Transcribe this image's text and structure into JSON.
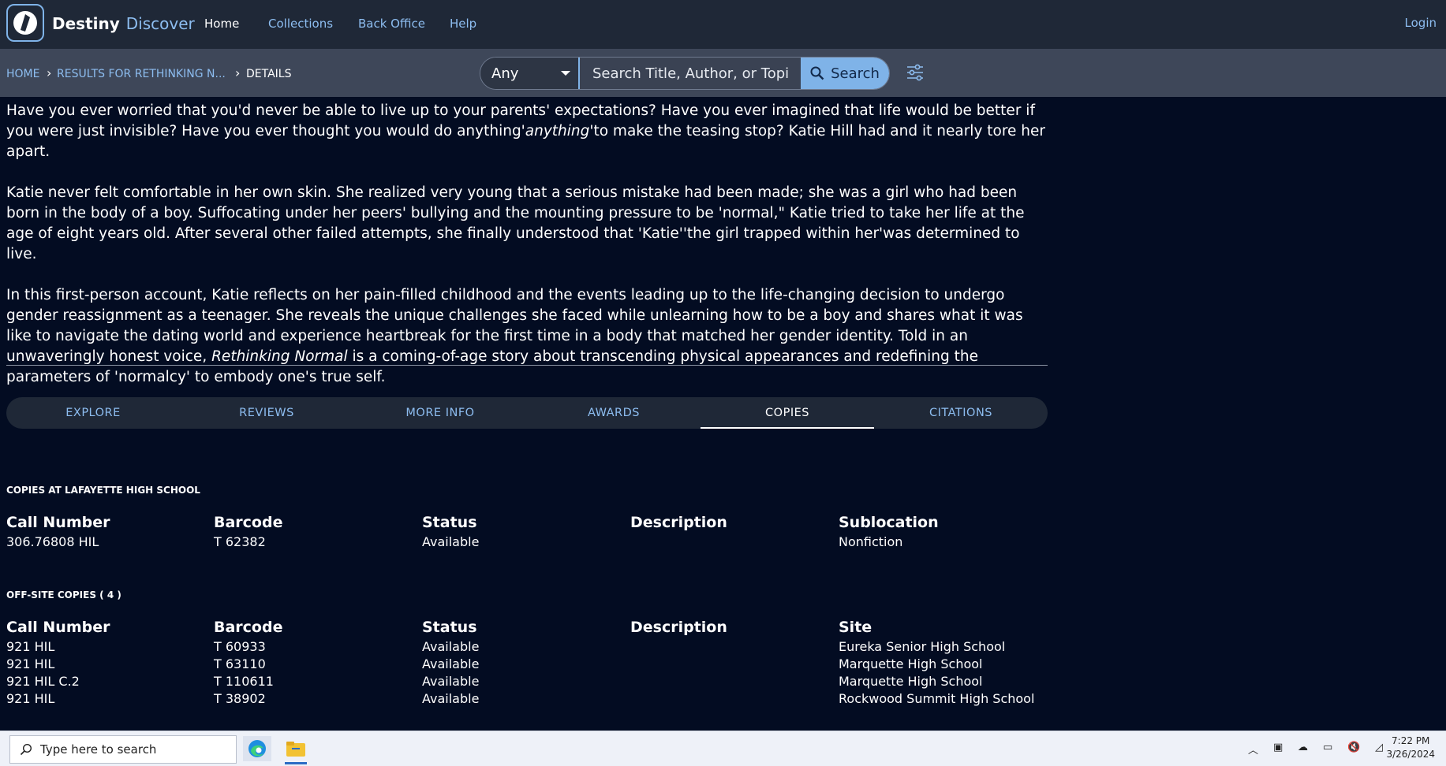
{
  "header": {
    "brand_primary": "Destiny",
    "brand_secondary": "Discover",
    "nav": [
      "Home",
      "Collections",
      "Back Office",
      "Help"
    ],
    "active_nav": "Home",
    "login": "Login"
  },
  "breadcrumb": [
    "HOME",
    "RESULTS FOR RETHINKING N...",
    "DETAILS"
  ],
  "search": {
    "scope": "Any",
    "placeholder": "Search Title, Author, or Topic",
    "button": "Search"
  },
  "description": {
    "p1a": "Have you ever worried that you'd never be able to live up to your parents' expectations? Have you ever imagined that life would be better if you were just invisible? Have you ever thought you would do anything'",
    "p1_em": "anything",
    "p1b": "'to make the teasing stop? Katie Hill had and it nearly tore her apart.",
    "p2": "Katie never felt comfortable in her own skin. She realized very young that a serious mistake had been made; she was a girl who had been born in the body of a boy. Suffocating under her peers' bullying and the mounting pressure to be 'normal,\" Katie tried to take her life at the age of eight years old. After several other failed attempts, she finally understood that 'Katie''the girl trapped within her'was determined to live.",
    "p3a": "In this first-person account, Katie reflects on her pain-filled childhood and the events leading up to the life-changing decision to undergo gender reassignment as a teenager. She reveals the unique challenges she faced while unlearning how to be a boy and shares what it was like to navigate the dating world and experience heartbreak for the first time in a body that matched her gender identity. Told in an unwaveringly honest voice, ",
    "p3_em": "Rethinking Normal",
    "p3b": " is a coming-of-age story about transcending physical appearances and redefining the parameters of 'normalcy' to embody one's true self."
  },
  "tabs": [
    "EXPLORE",
    "REVIEWS",
    "MORE INFO",
    "AWARDS",
    "COPIES",
    "CITATIONS"
  ],
  "active_tab": "COPIES",
  "local_copies": {
    "heading": "COPIES AT LAFAYETTE HIGH SCHOOL",
    "columns": [
      "Call Number",
      "Barcode",
      "Status",
      "Description",
      "Sublocation"
    ],
    "rows": [
      [
        "306.76808 HIL",
        "T 62382",
        "Available",
        "",
        "Nonfiction"
      ]
    ]
  },
  "offsite_copies": {
    "heading": "OFF-SITE COPIES ( 4 )",
    "columns": [
      "Call Number",
      "Barcode",
      "Status",
      "Description",
      "Site"
    ],
    "rows": [
      [
        "921 HIL",
        "T 60933",
        "Available",
        "",
        "Eureka Senior High School"
      ],
      [
        "921 HIL",
        "T 63110",
        "Available",
        "",
        "Marquette High School"
      ],
      [
        "921 HIL C.2",
        "T 110611",
        "Available",
        "",
        "Marquette High School"
      ],
      [
        "921 HIL",
        "T 38902",
        "Available",
        "",
        "Rockwood Summit High School"
      ]
    ]
  },
  "taskbar": {
    "search_placeholder": "Type here to search",
    "time": "7:22 PM",
    "date": "3/26/2024"
  }
}
